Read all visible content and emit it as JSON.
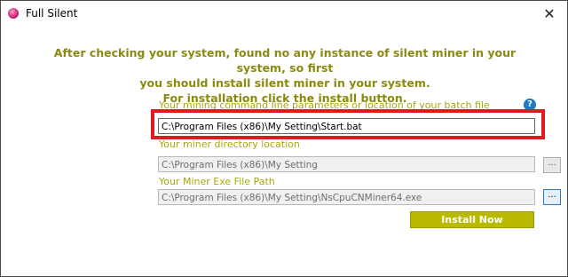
{
  "window": {
    "title": "Full Silent",
    "icon": "app-icon",
    "close_glyph": "✕"
  },
  "message": {
    "line1": "After checking your system, found no any instance of silent miner in your system, so first",
    "line2": "you should install silent miner in your system.",
    "line3": "For installation click the install button."
  },
  "fields": {
    "batch": {
      "label": "Your mining command line parameters or location of your batch file",
      "value": "C:\\Program Files (x86)\\My Setting\\Start.bat"
    },
    "directory": {
      "label": "Your miner directory location",
      "value": "C:\\Program Files (x86)\\My Setting",
      "browse_label": "..."
    },
    "exe": {
      "label": "Your Miner Exe File Path",
      "value": "C:\\Program Files (x86)\\My Setting\\NsCpuCNMiner64.exe",
      "browse_label": "..."
    }
  },
  "help": {
    "glyph": "?"
  },
  "install_button": {
    "label": "Install Now"
  },
  "colors": {
    "message_text": "#8a8a10",
    "label_text": "#a8a80c",
    "install_bg": "#b9b900",
    "highlight_border": "#e0191f",
    "help_bg": "#1f78c8"
  }
}
